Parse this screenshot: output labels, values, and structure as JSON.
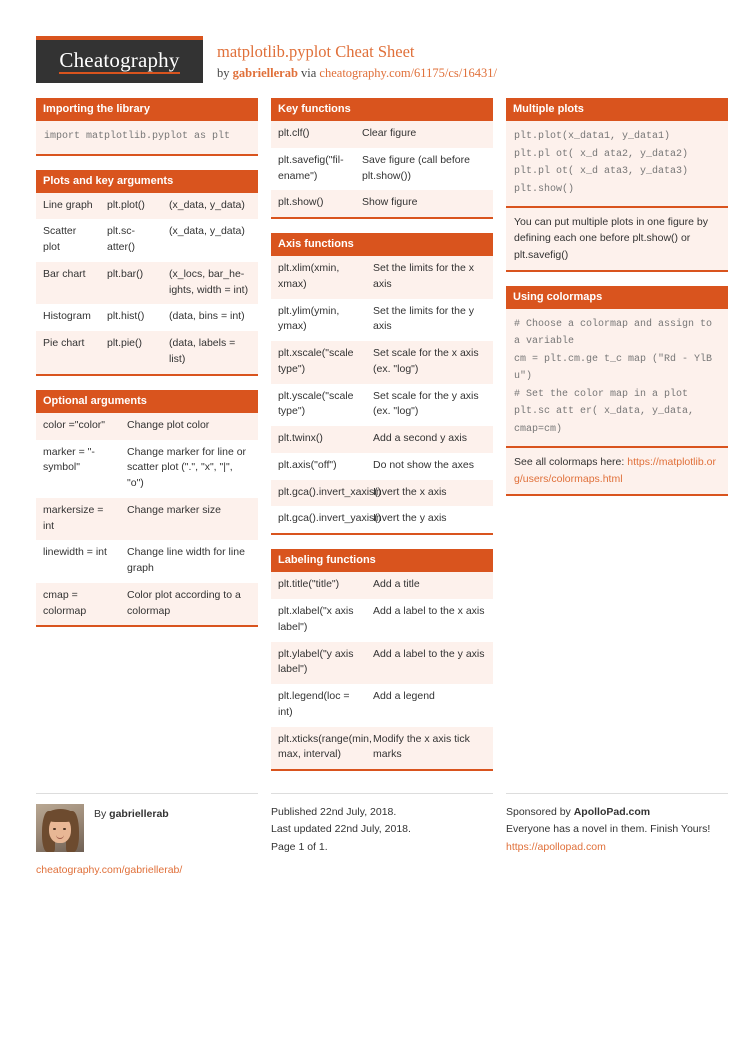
{
  "header": {
    "logo_text": "Cheatography",
    "title": "matplotlib.pyplot Cheat Sheet",
    "by_prefix": "by ",
    "author": "gabriellerab",
    "via": " via ",
    "source_url": "cheatography.com/61175/cs/16431/"
  },
  "colors": {
    "accent": "#d9541e",
    "accent_light": "#e0703a",
    "row_tint": "#fdf1ec",
    "logo_bg": "#333333"
  },
  "columns": [
    {
      "cards": [
        {
          "title": "Importing the library",
          "type": "code",
          "code": "import matplotlib.pyplot as plt"
        },
        {
          "title": "Plots and key arguments",
          "type": "table3",
          "rows": [
            [
              "Line graph",
              "plt.plot()",
              "(x_data, y_data)"
            ],
            [
              "Scatter plot",
              "plt.sc­atter()",
              "(x_data, y_data)"
            ],
            [
              "Bar chart",
              "plt.bar()",
              "(x_locs, bar_he­ights, width = int)"
            ],
            [
              "Histogram",
              "plt.hist()",
              "(data, bins = int)"
            ],
            [
              "Pie chart",
              "plt.pie()",
              "(data, labels = list)"
            ]
          ]
        },
        {
          "title": "Optional arguments",
          "type": "table2",
          "rows": [
            [
              "color =\"co­lor\"",
              "Change plot color"
            ],
            [
              "marker = \"-symbol\"",
              "Change marker for line or scatter plot (\".\", \"x\", \"|\", \"o\")"
            ],
            [
              "markersize = int",
              "Change marker size"
            ],
            [
              "linewidth = int",
              "Change line width for line graph"
            ],
            [
              "cmap = colormap",
              "Color plot according to a colormap"
            ]
          ]
        }
      ]
    },
    {
      "cards": [
        {
          "title": "Key functions",
          "type": "table2",
          "rows": [
            [
              "plt.clf()",
              "Clear figure"
            ],
            [
              "plt.savefig(\"fil­ename\")",
              "Save figure (call before plt.show())"
            ],
            [
              "plt.show()",
              "Show figure"
            ]
          ]
        },
        {
          "title": "Axis functions",
          "type": "table2",
          "rows": [
            [
              "plt.xlim(xmin, xmax)",
              "Set the limits for the x axis"
            ],
            [
              "plt.ylim(ymin, ymax)",
              "Set the limits for the y axis"
            ],
            [
              "plt.xscale(\"scale type\")",
              "Set scale for the x axis (ex. \"log\")"
            ],
            [
              "plt.yscale(\"scale type\")",
              "Set scale for the y axis (ex. \"log\")"
            ],
            [
              "plt.twinx()",
              "Add a second y axis"
            ],
            [
              "plt.axis(\"off\")",
              "Do not show the axes"
            ],
            [
              "plt.gca().invert_xaxis()",
              "Invert the x axis"
            ],
            [
              "plt.gca().invert_yaxis()",
              "Invert the y axis"
            ]
          ]
        },
        {
          "title": "Labeling functions",
          "type": "table2",
          "rows": [
            [
              "plt.title(\"title\")",
              "Add a title"
            ],
            [
              "plt.xlabel(\"x axis label\")",
              "Add a label to the x axis"
            ],
            [
              "plt.ylabel(\"y axis label\")",
              "Add a label to the y axis"
            ],
            [
              "plt.legend(loc = int)",
              "Add a legend"
            ],
            [
              "plt.xticks(range(min, max, interval)",
              "Modify the x axis tick marks"
            ]
          ]
        }
      ]
    },
    {
      "cards": [
        {
          "title": "Multiple plots",
          "type": "code_note",
          "code": "plt.plot(x_data1, y_data1)\nplt.pl ot( x_d ata2, y_data2)\nplt.pl ot( x_d ata3, y_data3)\nplt.show()",
          "note": "You can put multiple plots in one figure by defining each one before plt.show() or plt.savefig()"
        },
        {
          "title": "Using colormaps",
          "type": "code_link",
          "code": "# Choose a colormap and assign to a variable\ncm = plt.cm.ge t_c map (\"Rd - YlB u\")\n# Set the color map in a plot\nplt.sc att er( x_data, y_data, cmap=cm)",
          "note_prefix": "See all colormaps here: ",
          "note_link": "https://matplotlib.org/users/colormaps.html"
        }
      ]
    }
  ],
  "footer": {
    "author": {
      "by_label": "By ",
      "name": "gabriellerab",
      "link": "cheatography.com/gabriellerab/"
    },
    "publish": {
      "published": "Published 22nd July, 2018.",
      "updated": "Last updated 22nd July, 2018.",
      "page": "Page 1 of 1."
    },
    "sponsor": {
      "prefix": "Sponsored by ",
      "name": "ApolloPad.com",
      "tagline": "Everyone has a novel in them. Finish Yours!",
      "link": "https://apollopad.com"
    }
  }
}
